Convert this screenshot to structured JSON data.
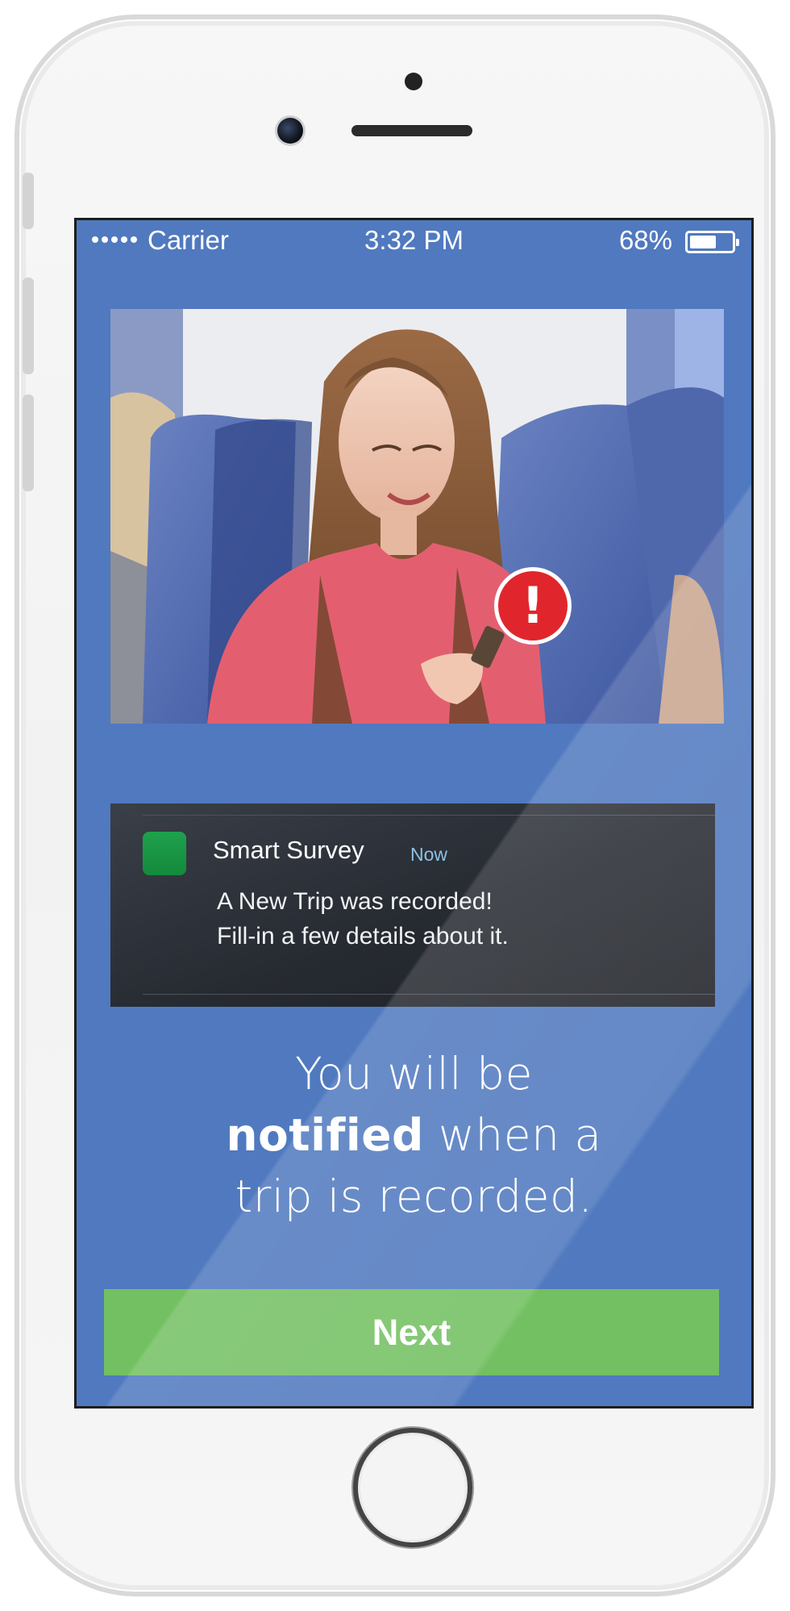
{
  "status_bar": {
    "carrier": "Carrier",
    "time": "3:32 PM",
    "battery_percent": "68%",
    "battery_level": 0.68
  },
  "photo": {
    "description_icon": "alert-exclamation-icon",
    "alert_symbol": "!"
  },
  "notification": {
    "app_name": "Smart Survey",
    "time_label": "Now",
    "line1": "A New Trip was recorded!",
    "line2": "Fill-in a few details about it.",
    "app_icon": "app-icon",
    "app_icon_color": "#1a9645"
  },
  "headline": {
    "part1": "You will be",
    "bold": "notified",
    "part2": " when a",
    "part3": "trip is recorded."
  },
  "next_button": {
    "label": "Next"
  },
  "colors": {
    "screen_background": "#5079bf",
    "next_button": "#73c062",
    "alert_badge": "#e0262c",
    "notification_background": "#2b2f36"
  }
}
